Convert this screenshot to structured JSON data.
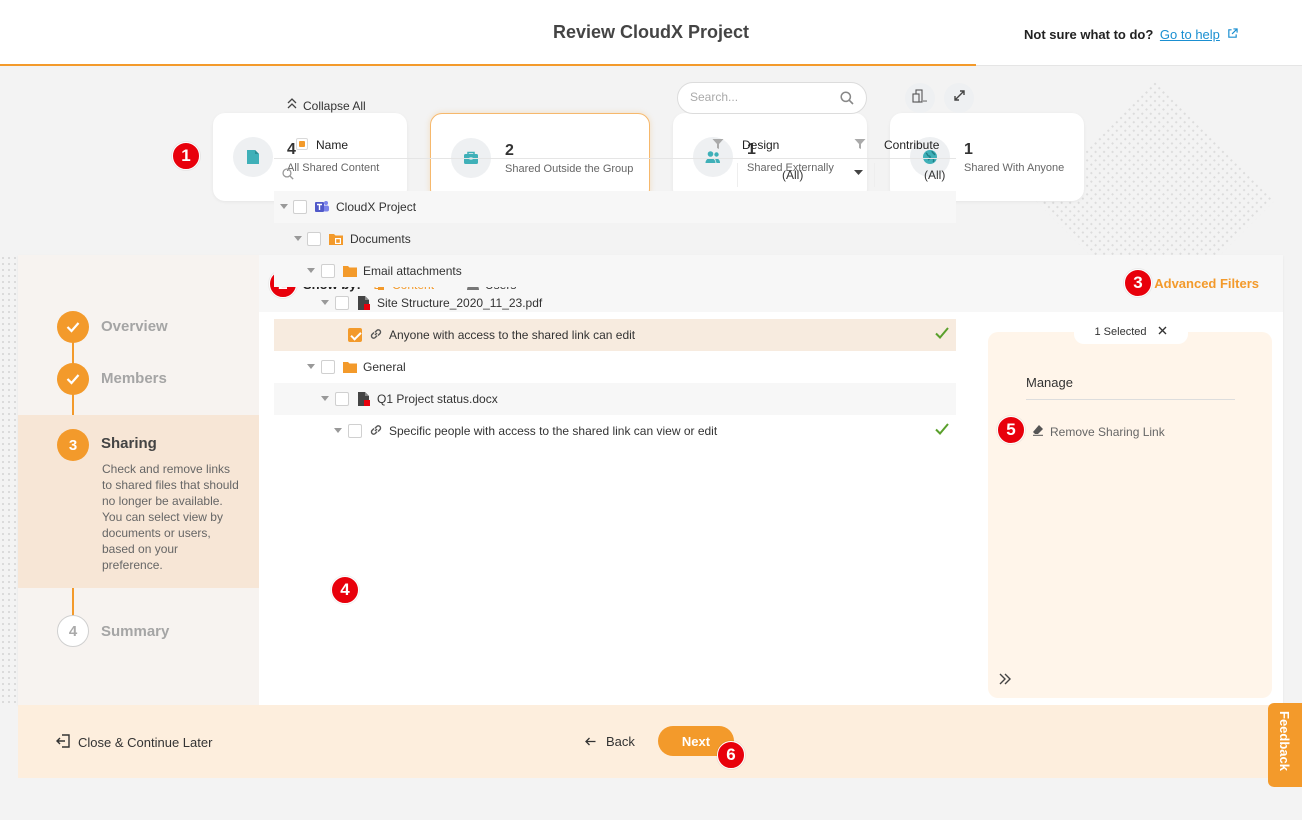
{
  "header": {
    "title": "Review CloudX Project",
    "help_prompt": "Not sure what to do?",
    "help_link": "Go to help"
  },
  "stats": [
    {
      "count": "4",
      "label": "All Shared Content",
      "icon": "document-icon"
    },
    {
      "count": "2",
      "label": "Shared Outside the Group",
      "icon": "briefcase-icon"
    },
    {
      "count": "1",
      "label": "Shared Externally",
      "icon": "users-icon"
    },
    {
      "count": "1",
      "label": "Shared With Anyone",
      "icon": "globe-icon"
    }
  ],
  "badges": [
    "1",
    "2",
    "3",
    "4",
    "5",
    "6"
  ],
  "steps": [
    {
      "num": "1",
      "title": "Overview",
      "state": "done"
    },
    {
      "num": "2",
      "title": "Members",
      "state": "done"
    },
    {
      "num": "3",
      "title": "Sharing",
      "state": "current",
      "description": "Check and remove links to shared files that should no longer be available. You can select view by documents or users, based on your preference."
    },
    {
      "num": "4",
      "title": "Summary",
      "state": "todo"
    }
  ],
  "toolbar": {
    "show_by_label": "Show by:",
    "tab_content": "Content",
    "tab_users": "Users",
    "advanced_filters": "Advanced Filters",
    "collapse_all": "Collapse All",
    "search_placeholder": "Search..."
  },
  "grid": {
    "columns": [
      "Name",
      "Design",
      "Contribute"
    ],
    "filter_design": "(All)",
    "filter_contribute": "(All)",
    "rows": [
      {
        "level": 0,
        "icon": "teams-icon",
        "label": "CloudX Project",
        "checked": false,
        "contribute_check": false
      },
      {
        "level": 1,
        "icon": "library-folder-icon",
        "label": "Documents",
        "checked": false,
        "contribute_check": false
      },
      {
        "level": 2,
        "icon": "folder-icon",
        "label": "Email attachments",
        "checked": false,
        "contribute_check": false
      },
      {
        "level": 3,
        "icon": "pdf-file-icon",
        "label": "Site Structure_2020_11_23.pdf",
        "checked": false,
        "contribute_check": false
      },
      {
        "level": 4,
        "icon": "link-icon",
        "label": "Anyone with access to the shared link can edit",
        "checked": true,
        "contribute_check": true
      },
      {
        "level": 2,
        "icon": "folder-icon",
        "label": "General",
        "checked": false,
        "contribute_check": false
      },
      {
        "level": 3,
        "icon": "docx-file-icon",
        "label": "Q1 Project status.docx",
        "checked": false,
        "contribute_check": false
      },
      {
        "level": 4,
        "icon": "link-icon",
        "label": "Specific people with access to the shared link can view or edit",
        "checked": false,
        "contribute_check": true
      }
    ]
  },
  "side_panel": {
    "selected_text": "1 Selected",
    "manage_label": "Manage",
    "remove_link_label": "Remove Sharing Link"
  },
  "footer": {
    "close_later": "Close & Continue Later",
    "back": "Back",
    "next": "Next"
  },
  "feedback_label": "Feedback",
  "colors": {
    "accent": "#f39a2b",
    "badge": "#e8000b",
    "link": "#1a8fd1",
    "success": "#5aa02c"
  }
}
